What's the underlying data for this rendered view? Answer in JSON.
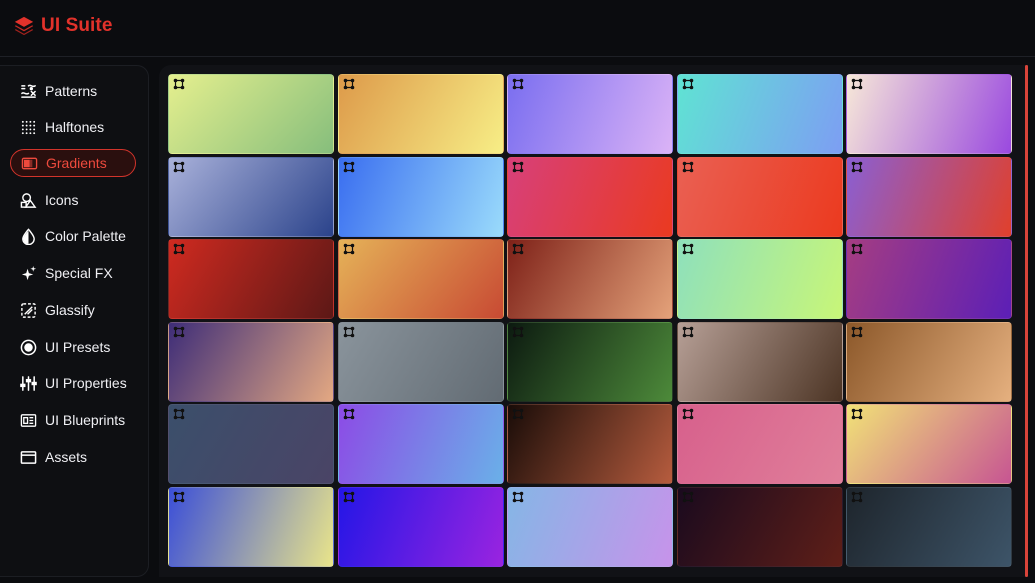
{
  "app": {
    "name": "UI Suite",
    "accent": "#e2322b",
    "logo_icon": "stack-layers-icon"
  },
  "sidebar": {
    "items": [
      {
        "label": "Patterns",
        "icon": "patterns-icon",
        "active": false
      },
      {
        "label": "Halftones",
        "icon": "halftone-grid-icon",
        "active": false
      },
      {
        "label": "Gradients",
        "icon": "gradient-icon",
        "active": true
      },
      {
        "label": "Icons",
        "icon": "shapes-icon",
        "active": false
      },
      {
        "label": "Color Palette",
        "icon": "drop-icon",
        "active": false
      },
      {
        "label": "Special FX",
        "icon": "sparkle-icon",
        "active": false
      },
      {
        "label": "Glassify",
        "icon": "glass-frame-icon",
        "active": false
      },
      {
        "label": "UI Presets",
        "icon": "radio-ring-icon",
        "active": false
      },
      {
        "label": "UI Properties",
        "icon": "sliders-icon",
        "active": false
      },
      {
        "label": "UI Blueprints",
        "icon": "blueprint-icon",
        "active": false
      },
      {
        "label": "Assets",
        "icon": "window-icon",
        "active": false
      }
    ]
  },
  "gradients": {
    "columns": 5,
    "swatch_icon": "move-handle-icon",
    "items": [
      {
        "from": "#e5ef8e",
        "to": "#86be7c",
        "angle": 135
      },
      {
        "from": "#dd9a4a",
        "to": "#f7ee86",
        "angle": 120
      },
      {
        "from": "#7a6ef0",
        "to": "#dbb3f6",
        "angle": 110
      },
      {
        "from": "#5fe3d3",
        "to": "#7d9ef3",
        "angle": 110
      },
      {
        "from": "#f7e8d8",
        "to": "#9a49df",
        "angle": 110
      },
      {
        "from": "#a9b1da",
        "to": "#2b438b",
        "angle": 130
      },
      {
        "from": "#3a6ef0",
        "to": "#9adbfb",
        "angle": 110
      },
      {
        "from": "#d7407a",
        "to": "#ea3a20",
        "angle": 110
      },
      {
        "from": "#ea6053",
        "to": "#eb3a1f",
        "angle": 110
      },
      {
        "from": "#8a5fd3",
        "to": "#e0402c",
        "angle": 110
      },
      {
        "from": "#cf2a20",
        "to": "#5c1816",
        "angle": 120
      },
      {
        "from": "#e5b258",
        "to": "#c84a33",
        "angle": 130
      },
      {
        "from": "#7e2118",
        "to": "#e4a27a",
        "angle": 120
      },
      {
        "from": "#8ee0bc",
        "to": "#c8f678",
        "angle": 110
      },
      {
        "from": "#a53d82",
        "to": "#5c1fb6",
        "angle": 110
      },
      {
        "from": "#3e2d78",
        "to": "#e3a882",
        "angle": 120
      },
      {
        "from": "#8a949c",
        "to": "#626b73",
        "angle": 120
      },
      {
        "from": "#0c1a10",
        "to": "#4d8a3a",
        "angle": 120
      },
      {
        "from": "#b69f96",
        "to": "#4c3424",
        "angle": 120
      },
      {
        "from": "#8c582a",
        "to": "#e5b07f",
        "angle": 120
      },
      {
        "from": "#3b4f6b",
        "to": "#4a4466",
        "angle": 120
      },
      {
        "from": "#8c4be6",
        "to": "#6ab0e8",
        "angle": 110
      },
      {
        "from": "#190c08",
        "to": "#b65c3e",
        "angle": 120
      },
      {
        "from": "#d7608c",
        "to": "#e07f9a",
        "angle": 120
      },
      {
        "from": "#f1e277",
        "to": "#c75592",
        "angle": 130
      },
      {
        "from": "#3b4fd8",
        "to": "#e9e58a",
        "angle": 110
      },
      {
        "from": "#2416e6",
        "to": "#9a24e0",
        "angle": 110
      },
      {
        "from": "#85b6e6",
        "to": "#c793ea",
        "angle": 110
      },
      {
        "from": "#1a0a1e",
        "to": "#5f1f18",
        "angle": 120
      },
      {
        "from": "#1e252c",
        "to": "#3d5468",
        "angle": 120
      }
    ]
  },
  "scrollbar": {
    "color": "#d9443a"
  }
}
